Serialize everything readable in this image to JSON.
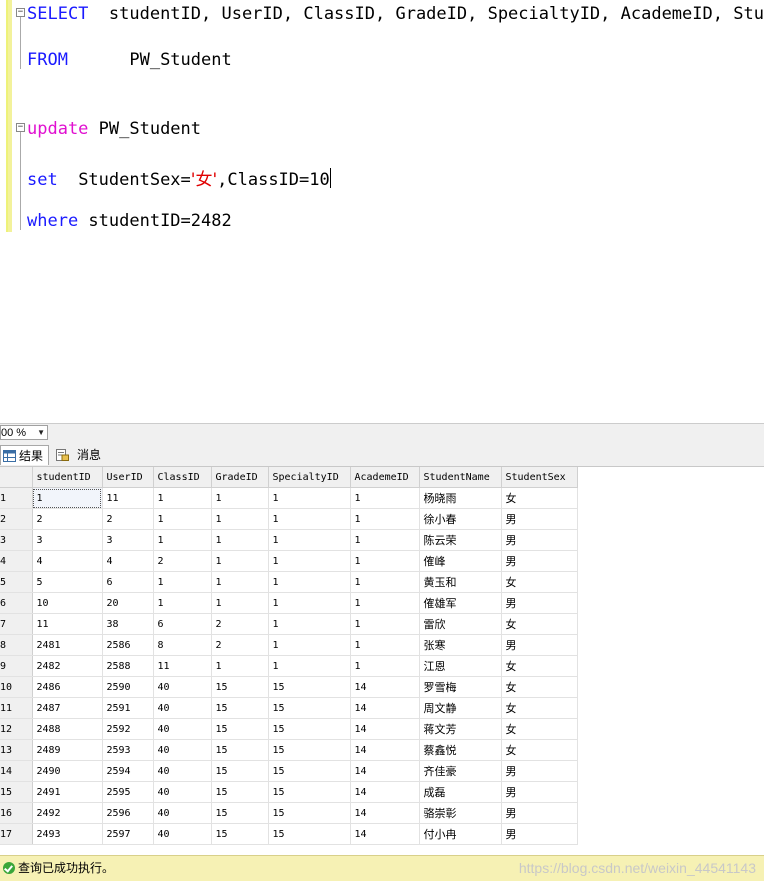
{
  "editor": {
    "lines": [
      {
        "kw": "SELECT",
        "rest": "  studentID, UserID, ClassID, GradeID, SpecialtyID, AcademeID, Stud"
      },
      {
        "kw": "FROM",
        "rest": "      PW_Student"
      },
      {
        "kw": "update",
        "rest": " PW_Student"
      },
      {
        "kw": "set",
        "rest": "  StudentSex=",
        "str": "'女'",
        "after": ",ClassID=10"
      },
      {
        "kw": "where",
        "rest": " studentID=2482"
      }
    ]
  },
  "zoom": {
    "value": "00 %"
  },
  "tabs": {
    "results": "结果",
    "messages": "消息"
  },
  "grid": {
    "columns": [
      "studentID",
      "UserID",
      "ClassID",
      "GradeID",
      "SpecialtyID",
      "AcademeID",
      "StudentName",
      "StudentSex"
    ],
    "rows": [
      [
        "1",
        "1",
        "11",
        "1",
        "1",
        "1",
        "1",
        "杨晓雨",
        "女"
      ],
      [
        "2",
        "2",
        "2",
        "1",
        "1",
        "1",
        "1",
        "徐小春",
        "男"
      ],
      [
        "3",
        "3",
        "3",
        "1",
        "1",
        "1",
        "1",
        "陈云荣",
        "男"
      ],
      [
        "4",
        "4",
        "4",
        "2",
        "1",
        "1",
        "1",
        "傕峰",
        "男"
      ],
      [
        "5",
        "5",
        "6",
        "1",
        "1",
        "1",
        "1",
        "黄玉和",
        "女"
      ],
      [
        "6",
        "10",
        "20",
        "1",
        "1",
        "1",
        "1",
        "傕雄军",
        "男"
      ],
      [
        "7",
        "11",
        "38",
        "6",
        "2",
        "1",
        "1",
        "雷欣",
        "女"
      ],
      [
        "8",
        "2481",
        "2586",
        "8",
        "2",
        "1",
        "1",
        "张寒",
        "男"
      ],
      [
        "9",
        "2482",
        "2588",
        "11",
        "1",
        "1",
        "1",
        "江恩",
        "女"
      ],
      [
        "10",
        "2486",
        "2590",
        "40",
        "15",
        "15",
        "14",
        "罗雪梅",
        "女"
      ],
      [
        "11",
        "2487",
        "2591",
        "40",
        "15",
        "15",
        "14",
        "周文静",
        "女"
      ],
      [
        "12",
        "2488",
        "2592",
        "40",
        "15",
        "15",
        "14",
        "蒋文芳",
        "女"
      ],
      [
        "13",
        "2489",
        "2593",
        "40",
        "15",
        "15",
        "14",
        "蔡鑫悦",
        "女"
      ],
      [
        "14",
        "2490",
        "2594",
        "40",
        "15",
        "15",
        "14",
        "齐佳豪",
        "男"
      ],
      [
        "15",
        "2491",
        "2595",
        "40",
        "15",
        "15",
        "14",
        "成磊",
        "男"
      ],
      [
        "16",
        "2492",
        "2596",
        "40",
        "15",
        "15",
        "14",
        "骆崇彰",
        "男"
      ],
      [
        "17",
        "2493",
        "2597",
        "40",
        "15",
        "15",
        "14",
        "付小冉",
        "男"
      ]
    ]
  },
  "status": {
    "text": "查询已成功执行。",
    "watermark": "https://blog.csdn.net/weixin_44541143"
  },
  "colors": {
    "keyword_blue": "#1a1aff",
    "keyword_pink": "#e010d0",
    "string_red": "#e00000",
    "status_bg": "#f6f1b4"
  }
}
